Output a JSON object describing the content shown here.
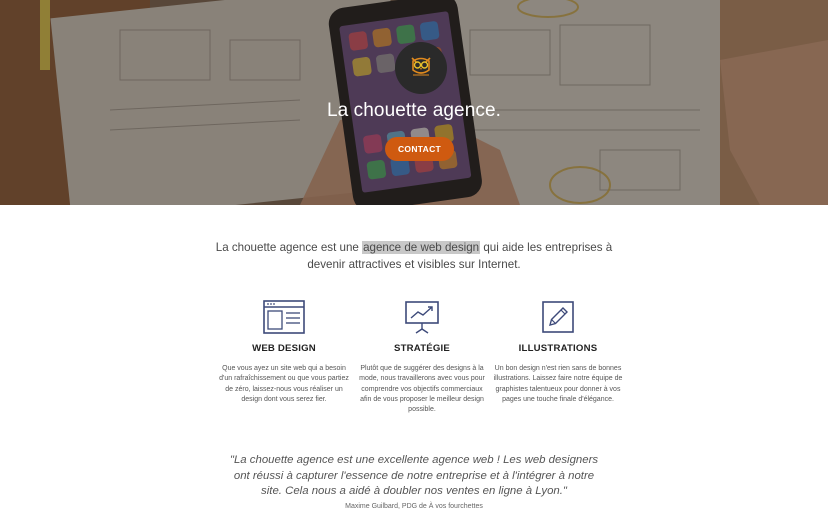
{
  "hero": {
    "title": "La chouette agence.",
    "contact_label": "CONTACT",
    "logo_icon": "owl-icon",
    "accent_color": "#cf5a10"
  },
  "intro": {
    "before": "La chouette agence est une ",
    "highlight": "agence de web design",
    "after": " qui aide les entreprises à devenir attractives et visibles sur Internet."
  },
  "services": [
    {
      "icon": "browser-window-icon",
      "title": "WEB DESIGN",
      "text": "Que vous ayez un site web qui a besoin d'un rafraîchissement ou que vous partiez de zéro, laissez-nous vous réaliser un design dont vous serez fier."
    },
    {
      "icon": "presentation-chart-icon",
      "title": "STRATÉGIE",
      "text": "Plutôt que de suggérer des designs à la mode, nous travaillerons avec vous pour comprendre vos objectifs commerciaux afin de vous proposer le meilleur design possible."
    },
    {
      "icon": "pencil-square-icon",
      "title": "ILLUSTRATIONS",
      "text": "Un bon design n'est rien sans de bonnes illustrations. Laissez faire notre équipe de graphistes talentueux pour donner à vos pages une touche finale d'élégance."
    }
  ],
  "testimonial": {
    "quote": "\"La chouette agence est une excellente agence web ! Les web designers ont réussi à capturer l'essence de notre entreprise et à l'intégrer à notre site. Cela nous a aidé à doubler nos ventes en ligne à Lyon.\"",
    "author": "Maxime Guilbard, PDG de À vos fourchettes"
  }
}
